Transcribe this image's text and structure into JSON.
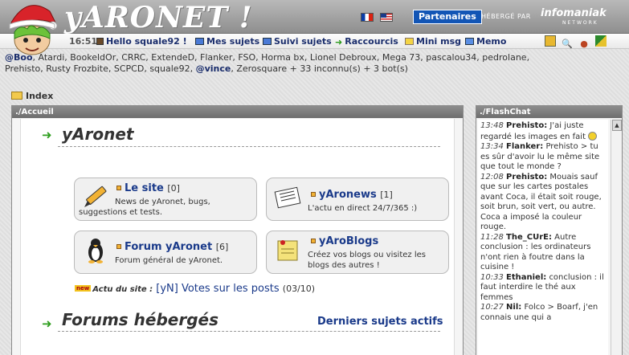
{
  "header": {
    "logo": "yARONET !",
    "partners": "Partenaires",
    "hosted_by": "HÉBERGÉ PAR",
    "host_brand": "infomaniak",
    "host_sub": "NETWORK"
  },
  "nav": {
    "time": "16:51",
    "greeting": "Hello squale92 !",
    "items": [
      "Mes sujets",
      "Suivi sujets",
      "Raccourcis",
      "Mini msg",
      "Memo"
    ]
  },
  "online": {
    "at_users": [
      "@Boo",
      "@vince"
    ],
    "line1": "Atardi, BookeldOr, CRRC, ExtendeD, Flanker, FSO, Horma bx, Lionel Debroux, Mega 73, pascalou34, pedrolane,",
    "line2_start": "Prehisto, Rusty Frozbite, SCPCD, squale92, ",
    "line2_end": ", Zerosquare + 33 inconnu(s) + 3 bot(s)"
  },
  "breadcrumb": {
    "index": "Index"
  },
  "main": {
    "head": "./Accueil",
    "title1": "yAronet",
    "title2": "Forums hébergés",
    "last_topics": "Derniers sujets actifs",
    "boxes": [
      {
        "title": "Le site",
        "count": "[0]",
        "desc": "News de yAronet, bugs, suggestions et tests."
      },
      {
        "title": "yAronews",
        "count": "[1]",
        "desc": "L'actu en direct 24/7/365 :)"
      },
      {
        "title": "Forum yAronet",
        "count": "[6]",
        "desc": "Forum général de yAronet."
      },
      {
        "title": "yAroBlogs",
        "count": "",
        "desc": "Créez vos blogs ou visitez les blogs des autres !"
      }
    ],
    "actu": {
      "badge": "new",
      "label": "Actu du site :",
      "link": "[yN] Votes sur les posts",
      "date": "(03/10)"
    }
  },
  "flashchat": {
    "head": "./FlashChat",
    "messages": [
      {
        "time": "13:48",
        "name": "Prehisto:",
        "text": "J'ai juste regardé les images en fait"
      },
      {
        "time": "13:34",
        "name": "Flanker:",
        "text": "Prehisto > tu es sûr d'avoir lu le même site que tout le monde ?"
      },
      {
        "time": "12:08",
        "name": "Prehisto:",
        "text": "Mouais sauf que sur les cartes postales avant Coca, il était soit rouge, soit brun, soit vert, ou autre. Coca a imposé la couleur rouge."
      },
      {
        "time": "11:28",
        "name": "The_CUrE:",
        "text": "Autre conclusion : les ordinateurs n'ont rien à foutre dans la cuisine !"
      },
      {
        "time": "10:33",
        "name": "Ethaniel:",
        "text": "conclusion : il faut interdire le thé aux femmes"
      },
      {
        "time": "10:27",
        "name": "Nil:",
        "text": "Folco > Boarf, j'en connais une qui a"
      }
    ]
  }
}
